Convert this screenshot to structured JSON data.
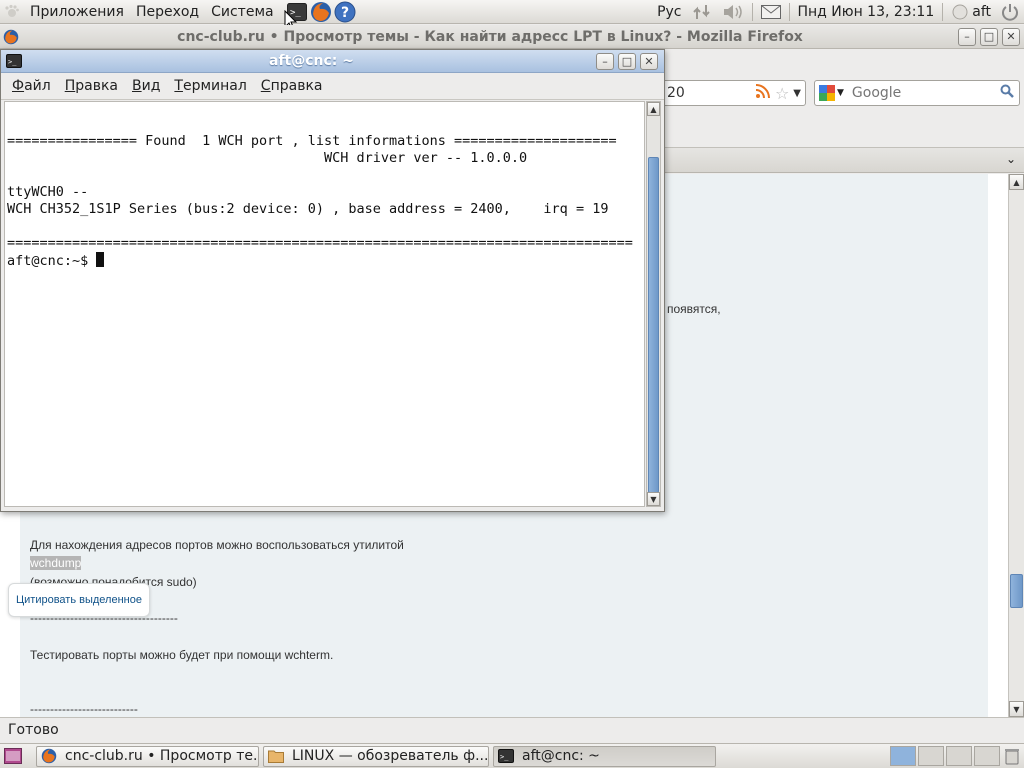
{
  "top_panel": {
    "menus": [
      "Приложения",
      "Переход",
      "Система"
    ],
    "keyboard_layout": "Рус",
    "clock": "Пнд Июн 13, 23:11",
    "user": "aft"
  },
  "firefox": {
    "title": "cnc-club.ru • Просмотр темы - Как найти адресс LPT в Linux? - Mozilla Firefox",
    "url_fragment": "20",
    "search_placeholder": "Google",
    "status": "Готово",
    "quote_popup": "Цитировать выделенное",
    "post_lines": {
      "fragment": "появятся,",
      "line1": "Для нахождения адресов портов можно воспользоваться утилитой",
      "line2": "wchdump",
      "line3": "(возможно понадобится sudo)",
      "separator1": "-------------------------------------",
      "line4": "Тестировать порты можно будет при помощи wchterm.",
      "separator2": "---------------------------"
    }
  },
  "terminal": {
    "title": "aft@cnc: ~",
    "menus": {
      "file": {
        "acc": "Ф",
        "rest": "айл"
      },
      "edit": {
        "acc": "П",
        "rest": "равка"
      },
      "view": {
        "acc": "В",
        "rest": "ид"
      },
      "terminal": {
        "acc": "Т",
        "rest": "ерминал"
      },
      "help": {
        "acc": "С",
        "rest": "правка"
      }
    },
    "output": "\n================ Found  1 WCH port , list informations ====================\n                                       WCH driver ver -- 1.0.0.0\n\nttyWCH0 --\nWCH CH352_1S1P Series (bus:2 device: 0) , base address = 2400,    irq = 19\n\n=============================================================================\n",
    "prompt": "aft@cnc:~$ "
  },
  "taskbar": {
    "tasks": [
      "cnc-club.ru • Просмотр те...",
      "LINUX — обозреватель ф...",
      "aft@cnc: ~"
    ]
  },
  "colors": {
    "terminal_titlebar": "#a9c1e0",
    "post_background": "#ecf1f3",
    "link_blue": "#105289"
  }
}
